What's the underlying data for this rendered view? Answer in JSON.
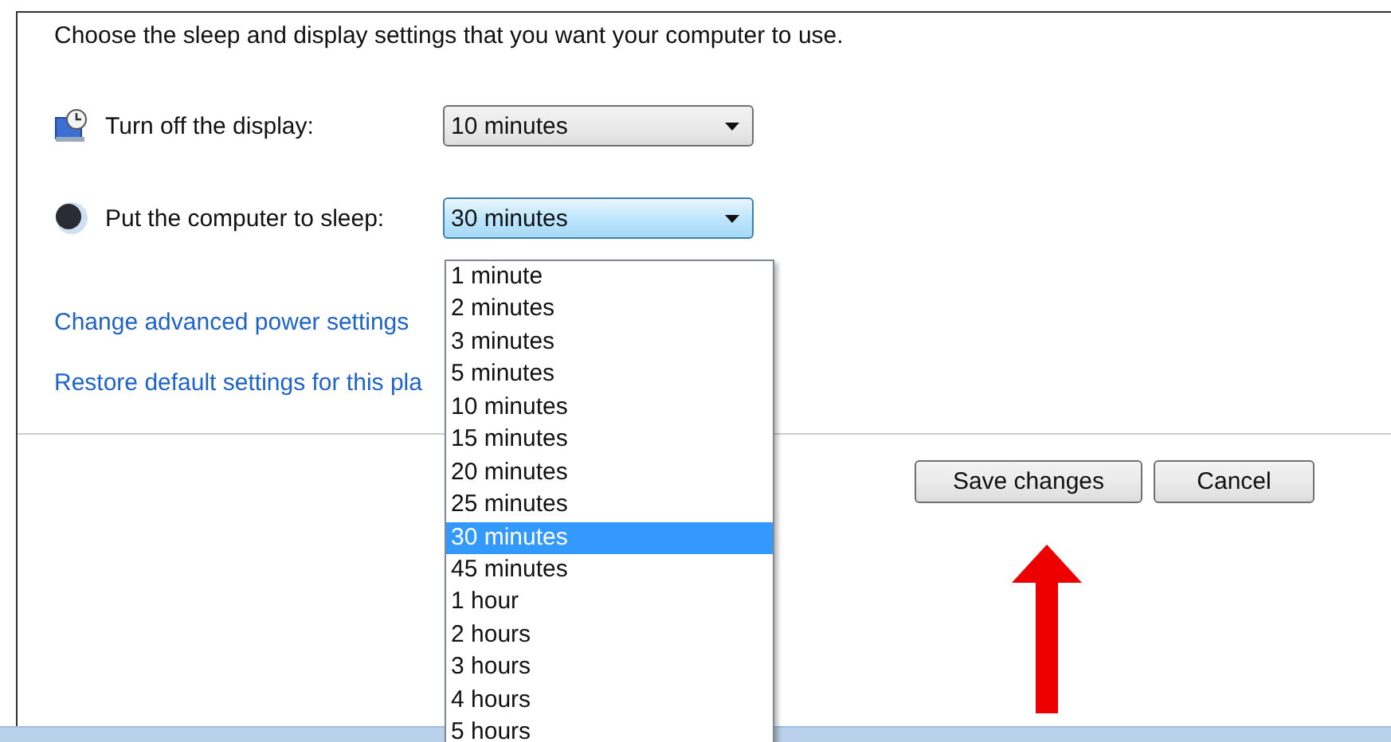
{
  "intro": "Choose the sleep and display settings that you want your computer to use.",
  "settings": [
    {
      "kind": "display",
      "label": "Turn off the display:",
      "value": "10 minutes",
      "expanded": false
    },
    {
      "kind": "sleep",
      "label": "Put the computer to sleep:",
      "value": "30 minutes",
      "expanded": true
    }
  ],
  "links": [
    "Change advanced power settings",
    "Restore default settings for this pla"
  ],
  "dropdown_options": [
    {
      "label": "1 minute",
      "selected": false
    },
    {
      "label": "2 minutes",
      "selected": false
    },
    {
      "label": "3 minutes",
      "selected": false
    },
    {
      "label": "5 minutes",
      "selected": false
    },
    {
      "label": "10 minutes",
      "selected": false
    },
    {
      "label": "15 minutes",
      "selected": false
    },
    {
      "label": "20 minutes",
      "selected": false
    },
    {
      "label": "25 minutes",
      "selected": false
    },
    {
      "label": "30 minutes",
      "selected": true
    },
    {
      "label": "45 minutes",
      "selected": false
    },
    {
      "label": "1 hour",
      "selected": false
    },
    {
      "label": "2 hours",
      "selected": false
    },
    {
      "label": "3 hours",
      "selected": false
    },
    {
      "label": "4 hours",
      "selected": false
    },
    {
      "label": "5 hours",
      "selected": false
    }
  ],
  "buttons": [
    "Save changes",
    "Cancel"
  ],
  "annotation": {
    "kind": "arrow"
  }
}
